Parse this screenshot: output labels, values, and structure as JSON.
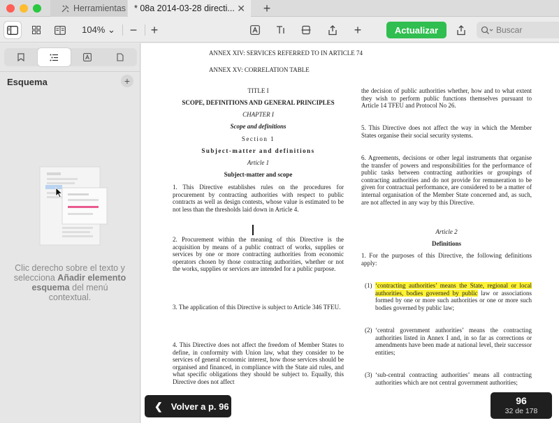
{
  "tabs": [
    {
      "label": "Herramientas",
      "icon": "tools-icon"
    },
    {
      "label": "* 08a 2014-03-28 directi...",
      "icon": "document-icon"
    }
  ],
  "toolbar": {
    "zoom_label": "104% ⌄",
    "update_label": "Actualizar",
    "search_placeholder": "Buscar"
  },
  "sidebar": {
    "title": "Esquema",
    "hint_pre": "Clic derecho sobre el texto y selecciona ",
    "hint_bold": "Añadir elemento esquema",
    "hint_post": " del menú contextual."
  },
  "document": {
    "annex14": "ANNEX XIV:  SERVICES REFERRED TO IN ARTICLE 74",
    "annex15": "ANNEX XV:   CORRELATION TABLE",
    "title1": "TITLE I",
    "title1_name": "SCOPE, DEFINITIONS AND GENERAL PRINCIPLES",
    "chapter": "CHAPTER I",
    "chapter_name": "Scope and definitions",
    "section": "Section 1",
    "section_name": "Subject-matter and definitions",
    "article1": "Article 1",
    "article1_name": "Subject-matter and scope",
    "p1": "1.    This Directive establishes rules on the procedures for procurement by contracting authorities with respect to public contracts as well as design contests, whose value is estimated to be not less than the thresholds laid down in Article 4.",
    "p2": "2.    Procurement within the meaning of this Directive is the acquisition by means of a public contract of works, supplies or services by one or more contracting authorities from economic operators chosen by those contracting authorities, whether or not the works, supplies or services are intended for a public purpose.",
    "p3": "3.    The application of this Directive is subject to Article 346 TFEU.",
    "p4": "4.    This Directive does not affect the freedom of Member States to define, in conformity with Union law, what they consider to be services of general economic interest, how those services should be organised and financed, in compliance with the State aid rules, and what specific obligations they should be subject to. Equally, this Directive does not affect",
    "r1": "the decision of public authorities whether, how and to what extent they wish to perform public functions themselves pursuant to Article 14 TFEU and Protocol No 26.",
    "r5": "5.    This Directive does not affect the way in which the Member States organise their social security systems.",
    "r6": "6.    Agreements, decisions or other legal instruments that organise the transfer of powers and responsibilities for the performance of public tasks between contracting authorities or groupings of contracting authorities and do not provide for remuneration to be given for contractual performance, are considered to be a matter of internal organisation of the Member State concerned and, as such, are not affected in any way by this Directive.",
    "article2": "Article 2",
    "article2_name": "Definitions",
    "r_def_intro": "1.    For the purposes of this Directive, the following defi­nitions apply:",
    "d1_num": "(1)",
    "d1_highlight": "‘contracting authorities’ means the State, regional or local authorities, bodies governed by public",
    "d1_rest": " law or associations formed by one or more such authorities or one or more such bodies governed by public law;",
    "d2_num": "(2)",
    "d2": "‘central government authorities’ means the contracting authorities listed in Annex I and, in so far as corrections or amendments have been made at national level, their successor entities;",
    "d3_num": "(3)",
    "d3": "‘sub-central contracting authorities’ means all contracting authorities which are not central government authorities;"
  },
  "navigation": {
    "back_label": "Volver a p. 96",
    "page_number": "96",
    "page_of": "32 de 178"
  },
  "colors": {
    "update_green": "#2fbe4f",
    "highlight_yellow": "#fef234"
  }
}
